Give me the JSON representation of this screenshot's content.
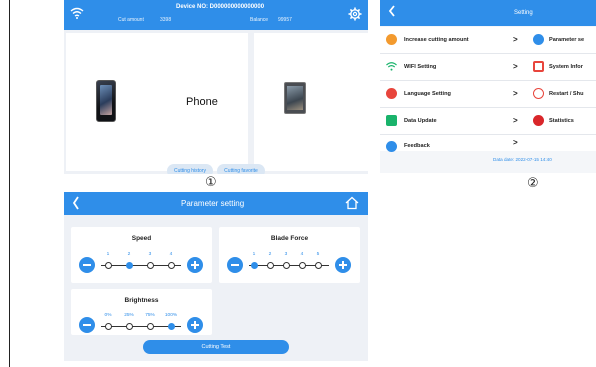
{
  "screen1": {
    "header": {
      "device_label": "Device NO: D000000000000000",
      "cut_amount_label": "Cut amount",
      "cut_amount_value": "3398",
      "balance_label": "Balance",
      "balance_value": "99957"
    },
    "category_main": "Phone",
    "buttons": {
      "history": "Cutting history",
      "favorite": "Cutting favorite"
    },
    "marker": "①"
  },
  "screen2": {
    "title": "Setting",
    "rows": [
      {
        "left": "Increase cutting amount",
        "right": "Parameter se"
      },
      {
        "left": "WIFI Setting",
        "right": "System Infor"
      },
      {
        "left": "Language Setting",
        "right": "Restart / Shu"
      },
      {
        "left": "Data Update",
        "right": "Statistics"
      },
      {
        "left": "Feedback",
        "right": ""
      }
    ],
    "chevron": ">",
    "date_text": "Data date: 2022-07-15 14:40",
    "marker": "②"
  },
  "screen3": {
    "title": "Parameter setting",
    "speed": {
      "label": "Speed",
      "ticks": [
        "1",
        "2",
        "3",
        "4"
      ],
      "selected_index": 1
    },
    "blade": {
      "label": "Blade Force",
      "ticks": [
        "1",
        "2",
        "3",
        "4",
        "5"
      ],
      "selected_index": 0
    },
    "brightness": {
      "label": "Brightness",
      "ticks": [
        "0%",
        "25%",
        "75%",
        "100%"
      ],
      "selected_index": 3
    },
    "cutting_test": "Cutting Test"
  },
  "colors": {
    "accent": "#2f8ee9",
    "background": "#eef1f6"
  },
  "icons": [
    "wifi-icon",
    "gear-icon",
    "back-icon",
    "home-icon"
  ]
}
